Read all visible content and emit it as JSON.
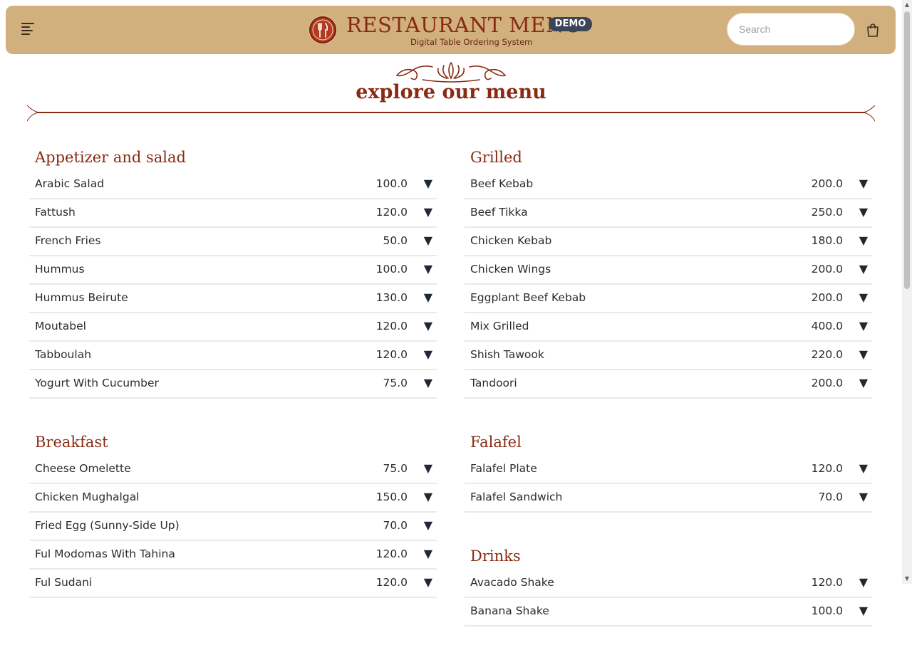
{
  "header": {
    "title": "RESTAURANT MENU",
    "badge": "DEMO",
    "subtitle": "Digital Table Ordering System",
    "search_placeholder": "Search",
    "icons": [
      "menu-icon",
      "fork-knife-logo-icon",
      "shopping-bag-icon"
    ]
  },
  "page": {
    "title": "explore our menu"
  },
  "colors": {
    "header_bg": "#d1b07e",
    "accent": "#8a2a13",
    "badge_bg": "#3b4556"
  },
  "categories_left": [
    {
      "name": "Appetizer and salad",
      "items": [
        {
          "name": "Arabic Salad",
          "price": "100.0"
        },
        {
          "name": "Fattush",
          "price": "120.0"
        },
        {
          "name": "French Fries",
          "price": "50.0"
        },
        {
          "name": "Hummus",
          "price": "100.0"
        },
        {
          "name": "Hummus Beirute",
          "price": "130.0"
        },
        {
          "name": "Moutabel",
          "price": "120.0"
        },
        {
          "name": "Tabboulah",
          "price": "120.0"
        },
        {
          "name": "Yogurt With Cucumber",
          "price": "75.0"
        }
      ]
    },
    {
      "name": "Breakfast",
      "items": [
        {
          "name": "Cheese Omelette",
          "price": "75.0"
        },
        {
          "name": "Chicken Mughalgal",
          "price": "150.0"
        },
        {
          "name": "Fried Egg (Sunny-Side Up)",
          "price": "70.0"
        },
        {
          "name": "Ful Modomas With Tahina",
          "price": "120.0"
        },
        {
          "name": "Ful Sudani",
          "price": "120.0"
        }
      ]
    }
  ],
  "categories_right": [
    {
      "name": "Grilled",
      "items": [
        {
          "name": "Beef Kebab",
          "price": "200.0"
        },
        {
          "name": "Beef Tikka",
          "price": "250.0"
        },
        {
          "name": "Chicken Kebab",
          "price": "180.0"
        },
        {
          "name": "Chicken Wings",
          "price": "200.0"
        },
        {
          "name": "Eggplant Beef Kebab",
          "price": "200.0"
        },
        {
          "name": "Mix Grilled",
          "price": "400.0"
        },
        {
          "name": "Shish Tawook",
          "price": "220.0"
        },
        {
          "name": "Tandoori",
          "price": "200.0"
        }
      ]
    },
    {
      "name": "Falafel",
      "items": [
        {
          "name": "Falafel Plate",
          "price": "120.0"
        },
        {
          "name": "Falafel Sandwich",
          "price": "70.0"
        }
      ]
    },
    {
      "name": "Drinks",
      "items": [
        {
          "name": "Avacado Shake",
          "price": "120.0"
        },
        {
          "name": "Banana Shake",
          "price": "100.0"
        }
      ]
    }
  ]
}
